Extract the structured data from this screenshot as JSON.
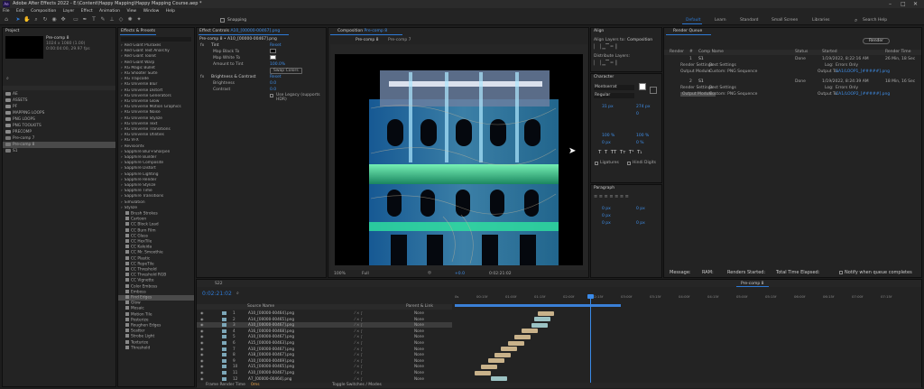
{
  "titlebar": {
    "title": "Adobe After Effects 2022 - E:\\Content\\Happy Mapping\\Happy Mapping Course.aep *",
    "min": "–",
    "max": "□",
    "close": "✕"
  },
  "menu": [
    "File",
    "Edit",
    "Composition",
    "Layer",
    "Effect",
    "Animation",
    "View",
    "Window",
    "Help"
  ],
  "toolbar": {
    "snapping": "Snapping"
  },
  "workspaces": [
    "Default",
    "Learn",
    "Standard",
    "Small Screen",
    "Libraries"
  ],
  "search_help": "Search Help",
  "project": {
    "title": "Project",
    "item_name": "Pre-comp 8",
    "item_info": "1024 x 1080 (1.00)",
    "item_duration": "0:00:04:00, 29.97 fps",
    "items": [
      "AE",
      "ASSETS",
      "PF",
      "MAPPING LOOPS",
      "PNG LOOPS",
      "PNG TOOLKITS",
      "PRECOMP",
      "Pre-comp 7",
      "Pre-comp 8",
      "S1"
    ]
  },
  "effects": {
    "title": "Effects & Presets",
    "items": [
      "Red Giant Pluraxes",
      "Red Giant Text Anarchy",
      "Red Giant Toonit",
      "Red Giant Warp",
      "RG Magic Bullet",
      "RG Shooter Suite",
      "RG Trapcode",
      "RG Universe Blur",
      "RG Universe Distort",
      "RG Universe Generators",
      "RG Universe Glow",
      "RG Universe Motion Graphics",
      "RG Universe Noise",
      "RG Universe Stylize",
      "RG Universe Text",
      "RG Universe Transitions",
      "RG Universe Utilities",
      "RG VFX",
      "Revisionfx",
      "Sapphire Blur+Sharpen",
      "Sapphire Builder",
      "Sapphire Composite",
      "Sapphire Distort",
      "Sapphire Lighting",
      "Sapphire Render",
      "Sapphire Stylize",
      "Sapphire Time",
      "Sapphire Transitions",
      "Simulation",
      "Stylize"
    ],
    "stylize": [
      "Brush Strokes",
      "Cartoon",
      "CC Block Load",
      "CC Burn Film",
      "CC Glass",
      "CC HexTile",
      "CC Kaleida",
      "CC Mr. Smoothie",
      "CC Plastic",
      "CC RepeTile",
      "CC Threshold",
      "CC Threshold RGB",
      "CC Vignette",
      "Color Emboss",
      "Emboss",
      "Find Edges",
      "Glow",
      "Mosaic",
      "Motion Tile",
      "Posterize",
      "Roughen Edges",
      "Scatter",
      "Strobe Light",
      "Texturize",
      "Threshold"
    ],
    "selected": "Find Edges"
  },
  "effect_controls": {
    "title": "Effect Controls",
    "layer": "A10_[00000-00467].png",
    "header": "Pre-comp 8 • A10_[00000-00467].png",
    "tint": {
      "name": "Tint",
      "reset": "Reset",
      "map_black": "Map Black To",
      "map_white": "Map White To",
      "amount": "Amount to Tint",
      "amount_val": "100.0%",
      "swap": "Swap Colors"
    },
    "bc": {
      "name": "Brightness & Contrast",
      "reset": "Reset",
      "brightness": "Brightness",
      "brightness_val": "0.0",
      "contrast": "Contrast",
      "contrast_val": "0.0",
      "legacy": "Use Legacy (supports HDR)"
    }
  },
  "composition": {
    "title": "Composition",
    "comp": "Pre-comp 8",
    "crumbs": [
      "Pre-comp 8",
      "Pre-comp 7"
    ],
    "zoom": "100%",
    "quality": "Full",
    "timecode": "0:02:21:02",
    "frames": "+0.0"
  },
  "align": {
    "title": "Align",
    "tab2": "Composition",
    "align_to": "Align Layers to:",
    "distribute": "Distribute Layers:"
  },
  "character": {
    "title": "Character",
    "font": "Montserrat",
    "style": "Regular",
    "size": "31 px",
    "leading": "274 px",
    "tracking": "0",
    "stroke": "100 %",
    "stroke2": "100 %",
    "shift": "0 px",
    "tsume": "0 %",
    "ligatures": "Ligatures",
    "hindi": "Hindi Digits"
  },
  "paragraph": {
    "title": "Paragraph",
    "indent1": "0 px",
    "indent2": "0 px",
    "indent3": "0 px",
    "space1": "0 px",
    "space2": "0 px"
  },
  "render_queue": {
    "title": "Render Queue",
    "render_btn": "Render",
    "cols": [
      "Render",
      "#",
      "Comp Name",
      "Status",
      "Started",
      "Render Time"
    ],
    "rows": [
      {
        "num": "1",
        "name": "S1",
        "status": "Done",
        "started": "1/19/2022, 8:22:16 AM",
        "time": "26 Min, 18 Sec"
      },
      {
        "num": "2",
        "name": "S1",
        "status": "Done",
        "started": "1/19/2022, 8:24:39 AM",
        "time": "18 Min, 16 Sec"
      }
    ],
    "render_settings": "Render Settings:",
    "best": "Best Settings",
    "output_module": "Output Module:",
    "custom_png": "Custom: PNG Sequence",
    "log": "Log:",
    "errors_only": "Errors Only",
    "output_to": "Output To:",
    "file1": "SA1/LOOP1_[#####].png",
    "file2": "CA1/LOOP2_[#####].png",
    "message": "Message:",
    "ram": "RAM:",
    "renders_started": "Renders Started:",
    "total_time": "Total Time Elapsed:",
    "notify": "Notify when queue completes"
  },
  "timeline": {
    "tabs": [
      "S22",
      "Pre-comp 8"
    ],
    "timecode": "0:02:21:02",
    "layer_col": "Source Name",
    "parent_col": "Parent & Link",
    "layers": [
      {
        "num": "1",
        "name": "A10_[00000-00464].png"
      },
      {
        "num": "2",
        "name": "A14_[00000-00465].png"
      },
      {
        "num": "3",
        "name": "A10_[00000-00467].png"
      },
      {
        "num": "4",
        "name": "A16_[00000-00468].png"
      },
      {
        "num": "5",
        "name": "A10_[00000-00467].png"
      },
      {
        "num": "6",
        "name": "A15_[00000-00463].png"
      },
      {
        "num": "7",
        "name": "A10_[00000-00467].png"
      },
      {
        "num": "8",
        "name": "A18_[00000-00467].png"
      },
      {
        "num": "9",
        "name": "A10_[00000-00469].png"
      },
      {
        "num": "10",
        "name": "A15_[00000-00465].png"
      },
      {
        "num": "11",
        "name": "A10_[00000-00467].png"
      },
      {
        "num": "12",
        "name": "A7_[00000-00464].png"
      }
    ],
    "parent_val": "None",
    "ruler": [
      "0s",
      "00:15f",
      "01:00f",
      "01:15f",
      "02:00f",
      "02:15f",
      "03:00f",
      "03:15f",
      "04:00f",
      "04:15f",
      "05:00f",
      "05:15f",
      "06:00f",
      "06:15f",
      "07:00f",
      "07:15f"
    ],
    "footer_left": "Frame Render Time",
    "footer_ms": "0ms",
    "footer_mid": "Toggle Switches / Modes"
  },
  "colors": {
    "accent": "#2e7ad6",
    "selection": "#4a4a4a",
    "track": "#c9b28a",
    "track_teal": "#9cc3c4",
    "work_area": "#3a7fd6"
  }
}
